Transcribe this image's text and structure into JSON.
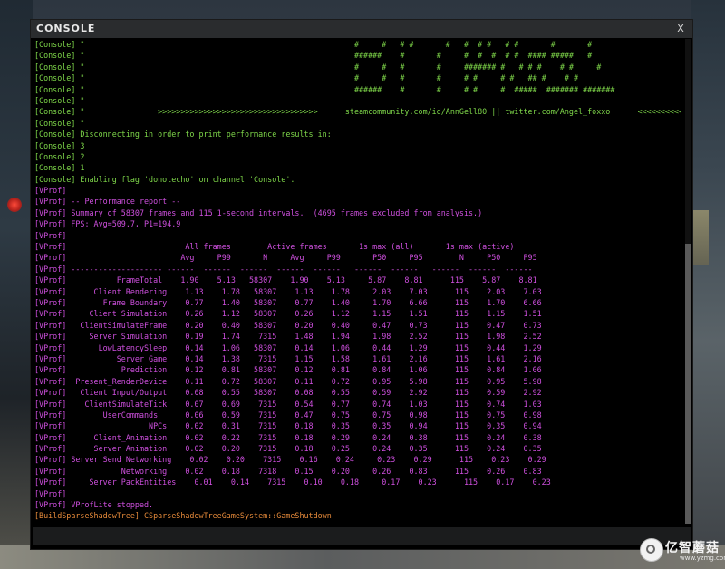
{
  "window": {
    "title": "CONSOLE",
    "close_label": "X"
  },
  "colors": {
    "console": "#7fd84a",
    "vprof": "#d050e0",
    "warning": "#e68a3a"
  },
  "log": [
    {
      "t": "console",
      "text": "[Console] \"                                                           #     #   # #       #   #  # #   # #       #       #"
    },
    {
      "t": "console",
      "text": "[Console] \"                                                           ######    #       #     #  #  #  # #  #### #####   #"
    },
    {
      "t": "console",
      "text": "[Console] \"                                                           #     #   #       #     ####### #   # # #    # #     #"
    },
    {
      "t": "console",
      "text": "[Console] \"                                                           #     #   #       #     # #     # #   ## #    # #"
    },
    {
      "t": "console",
      "text": "[Console] \"                                                           ######    #       #     # #     #  #####  ####### #######"
    },
    {
      "t": "console",
      "text": "[Console] \""
    },
    {
      "t": "console",
      "text": "[Console] \"                >>>>>>>>>>>>>>>>>>>>>>>>>>>>>>>>>>>      steamcommunity.com/id/AnnGell80 || twitter.com/Angel_foxxo      <<<<<<<<<<<<<<<<<<<<<<<<<<<<<<"
    },
    {
      "t": "console",
      "text": "[Console] \""
    },
    {
      "t": "console",
      "text": "[Console] Disconnecting in order to print performance results in:"
    },
    {
      "t": "console",
      "text": "[Console] 3"
    },
    {
      "t": "console",
      "text": "[Console] 2"
    },
    {
      "t": "console",
      "text": "[Console] 1"
    },
    {
      "t": "console",
      "text": "[Console] Enabling flag 'donotecho' on channel 'Console'."
    },
    {
      "t": "vprof",
      "text": "[VProf]"
    },
    {
      "t": "vprof",
      "text": "[VProf] -- Performance report --"
    },
    {
      "t": "vprof",
      "text": "[VProf] Summary of 58307 frames and 115 1-second intervals.  (4695 frames excluded from analysis.)"
    },
    {
      "t": "vprof",
      "text": "[VProf] FPS: Avg=509.7, P1=194.9"
    },
    {
      "t": "vprof",
      "text": "[VProf]"
    },
    {
      "t": "vprof",
      "text": "[VProf]                          All frames        Active frames       1s max (all)       1s max (active)"
    },
    {
      "t": "vprof",
      "text": "[VProf]                         Avg     P99       N     Avg     P99       P50     P95        N     P50     P95"
    },
    {
      "t": "vprof",
      "text": "[VProf] -------------------- ------  ------  ------  ------  ------   ------  ------   ------  ------  ------"
    },
    {
      "t": "vprof",
      "text": "[VProf]           FrameTotal    1.90    5.13   58307    1.90    5.13     5.87    8.81      115    5.87    8.81"
    },
    {
      "t": "vprof",
      "text": "[VProf]      Client Rendering    1.13    1.78   58307    1.13    1.78     2.03    7.03      115    2.03    7.03"
    },
    {
      "t": "vprof",
      "text": "[VProf]        Frame Boundary    0.77    1.40   58307    0.77    1.40     1.70    6.66      115    1.70    6.66"
    },
    {
      "t": "vprof",
      "text": "[VProf]     Client Simulation    0.26    1.12   58307    0.26    1.12     1.15    1.51      115    1.15    1.51"
    },
    {
      "t": "vprof",
      "text": "[VProf]   ClientSimulateFrame    0.20    0.40   58307    0.20    0.40     0.47    0.73      115    0.47    0.73"
    },
    {
      "t": "vprof",
      "text": "[VProf]     Server Simulation    0.19    1.74    7315    1.48    1.94     1.98    2.52      115    1.98    2.52"
    },
    {
      "t": "vprof",
      "text": "[VProf]       LowLatencySleep    0.14    1.06   58307    0.14    1.06     0.44    1.29      115    0.44    1.29"
    },
    {
      "t": "vprof",
      "text": "[VProf]           Server Game    0.14    1.38    7315    1.15    1.58     1.61    2.16      115    1.61    2.16"
    },
    {
      "t": "vprof",
      "text": "[VProf]            Prediction    0.12    0.81   58307    0.12    0.81     0.84    1.06      115    0.84    1.06"
    },
    {
      "t": "vprof",
      "text": "[VProf]  Present_RenderDevice    0.11    0.72   58307    0.11    0.72     0.95    5.98      115    0.95    5.98"
    },
    {
      "t": "vprof",
      "text": "[VProf]   Client Input/Output    0.08    0.55   58307    0.08    0.55     0.59    2.92      115    0.59    2.92"
    },
    {
      "t": "vprof",
      "text": "[VProf]    ClientSimulateTick    0.07    0.69    7315    0.54    0.77     0.74    1.03      115    0.74    1.03"
    },
    {
      "t": "vprof",
      "text": "[VProf]        UserCommands      0.06    0.59    7315    0.47    0.75     0.75    0.98      115    0.75    0.98"
    },
    {
      "t": "vprof",
      "text": "[VProf]                  NPCs    0.02    0.31    7315    0.18    0.35     0.35    0.94      115    0.35    0.94"
    },
    {
      "t": "vprof",
      "text": "[VProf]      Client_Animation    0.02    0.22    7315    0.18    0.29     0.24    0.38      115    0.24    0.38"
    },
    {
      "t": "vprof",
      "text": "[VProf]      Server Animation    0.02    0.20    7315    0.18    0.25     0.24    0.35      115    0.24    0.35"
    },
    {
      "t": "vprof",
      "text": "[VProf] Server Send Networking    0.02    0.20    7315    0.16    0.24     0.23    0.29      115    0.23    0.29"
    },
    {
      "t": "vprof",
      "text": "[VProf]            Networking    0.02    0.18    7318    0.15    0.20     0.26    0.83      115    0.26    0.83"
    },
    {
      "t": "vprof",
      "text": "[VProf]     Server PackEntities    0.01    0.14    7315    0.10    0.18     0.17    0.23      115    0.17    0.23"
    },
    {
      "t": "vprof",
      "text": "[VProf]"
    },
    {
      "t": "vprof",
      "text": "[VProf] VProfLite stopped."
    },
    {
      "t": "warn",
      "text": "[BuildSparseShadowTree] CSparseShadowTreeGameSystem::GameShutdown"
    }
  ],
  "input": {
    "value": "",
    "placeholder": ""
  },
  "watermark": {
    "brand": "亿智蘑菇",
    "url": "www.yzmg.com",
    "icon": "mushroom-logo-icon"
  }
}
